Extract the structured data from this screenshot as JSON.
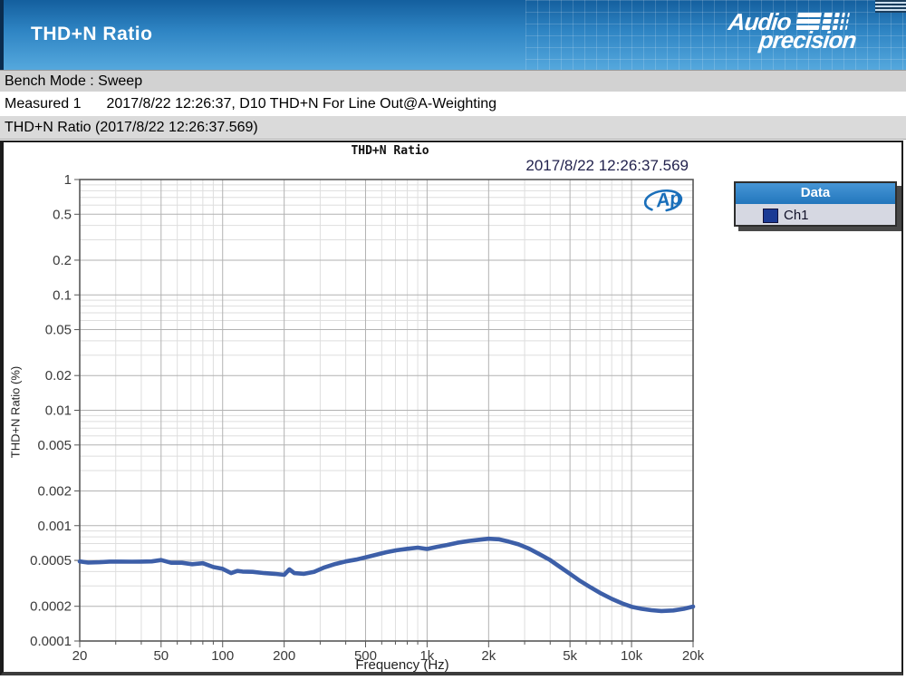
{
  "header": {
    "title": "THD+N Ratio",
    "logo_line1": "Audio",
    "logo_line2": "precision"
  },
  "info": {
    "bench_mode": "Bench Mode : Sweep",
    "measured_label": "Measured 1",
    "measured_value": "2017/8/22 12:26:37, D10 THD+N For Line Out@A-Weighting",
    "graph_title_bar": "THD+N Ratio (2017/8/22 12:26:37.569)"
  },
  "chart": {
    "timestamp": "2017/8/22 12:26:37.569",
    "ap_logo": "Ap"
  },
  "legend": {
    "title": "Data",
    "swatch_color": "#1b3a94"
  },
  "chart_data": {
    "type": "line",
    "title": "THD+N Ratio",
    "xlabel": "Frequency (Hz)",
    "ylabel": "THD+N Ratio (%)",
    "xscale": "log",
    "yscale": "log",
    "xlim": [
      20,
      20000
    ],
    "ylim": [
      0.0001,
      1
    ],
    "grid": true,
    "legend_position": "top-right",
    "xticks": [
      {
        "v": 20,
        "label": "20"
      },
      {
        "v": 50,
        "label": "50"
      },
      {
        "v": 100,
        "label": "100"
      },
      {
        "v": 200,
        "label": "200"
      },
      {
        "v": 500,
        "label": "500"
      },
      {
        "v": 1000,
        "label": "1k"
      },
      {
        "v": 2000,
        "label": "2k"
      },
      {
        "v": 5000,
        "label": "5k"
      },
      {
        "v": 10000,
        "label": "10k"
      },
      {
        "v": 20000,
        "label": "20k"
      }
    ],
    "yticks": [
      {
        "v": 1,
        "label": "1"
      },
      {
        "v": 0.5,
        "label": "0.5"
      },
      {
        "v": 0.2,
        "label": "0.2"
      },
      {
        "v": 0.1,
        "label": "0.1"
      },
      {
        "v": 0.05,
        "label": "0.05"
      },
      {
        "v": 0.02,
        "label": "0.02"
      },
      {
        "v": 0.01,
        "label": "0.01"
      },
      {
        "v": 0.005,
        "label": "0.005"
      },
      {
        "v": 0.002,
        "label": "0.002"
      },
      {
        "v": 0.001,
        "label": "0.001"
      },
      {
        "v": 0.0005,
        "label": "0.0005"
      },
      {
        "v": 0.0002,
        "label": "0.0002"
      },
      {
        "v": 0.0001,
        "label": "0.0001"
      }
    ],
    "series": [
      {
        "name": "Ch1",
        "color": "#3d5fa8",
        "points": [
          [
            20,
            0.00049
          ],
          [
            22,
            0.000478
          ],
          [
            25,
            0.000482
          ],
          [
            28,
            0.000488
          ],
          [
            32,
            0.000488
          ],
          [
            36,
            0.000487
          ],
          [
            40,
            0.000488
          ],
          [
            45,
            0.00049
          ],
          [
            50,
            0.000503
          ],
          [
            56,
            0.000477
          ],
          [
            63,
            0.000477
          ],
          [
            71,
            0.000463
          ],
          [
            80,
            0.000472
          ],
          [
            90,
            0.000438
          ],
          [
            100,
            0.000422
          ],
          [
            110,
            0.000388
          ],
          [
            118,
            0.000405
          ],
          [
            125,
            0.0004
          ],
          [
            140,
            0.000398
          ],
          [
            160,
            0.000388
          ],
          [
            180,
            0.000382
          ],
          [
            200,
            0.000375
          ],
          [
            212,
            0.000418
          ],
          [
            224,
            0.000388
          ],
          [
            250,
            0.000382
          ],
          [
            280,
            0.000398
          ],
          [
            315,
            0.000435
          ],
          [
            355,
            0.000465
          ],
          [
            400,
            0.00049
          ],
          [
            450,
            0.000508
          ],
          [
            500,
            0.00053
          ],
          [
            560,
            0.000558
          ],
          [
            630,
            0.000588
          ],
          [
            710,
            0.000612
          ],
          [
            800,
            0.00063
          ],
          [
            900,
            0.000645
          ],
          [
            1000,
            0.000628
          ],
          [
            1120,
            0.000655
          ],
          [
            1250,
            0.00068
          ],
          [
            1400,
            0.00071
          ],
          [
            1600,
            0.000737
          ],
          [
            1800,
            0.000755
          ],
          [
            2000,
            0.00077
          ],
          [
            2240,
            0.000762
          ],
          [
            2500,
            0.000728
          ],
          [
            2800,
            0.000688
          ],
          [
            3150,
            0.000632
          ],
          [
            3550,
            0.000565
          ],
          [
            4000,
            0.000502
          ],
          [
            4500,
            0.000435
          ],
          [
            5000,
            0.000382
          ],
          [
            5600,
            0.000332
          ],
          [
            6300,
            0.000292
          ],
          [
            7100,
            0.000258
          ],
          [
            8000,
            0.000232
          ],
          [
            9000,
            0.000212
          ],
          [
            10000,
            0.000198
          ],
          [
            11200,
            0.00019
          ],
          [
            12500,
            0.000185
          ],
          [
            14000,
            0.000182
          ],
          [
            16000,
            0.000184
          ],
          [
            18000,
            0.00019
          ],
          [
            20000,
            0.000199
          ]
        ]
      }
    ]
  }
}
